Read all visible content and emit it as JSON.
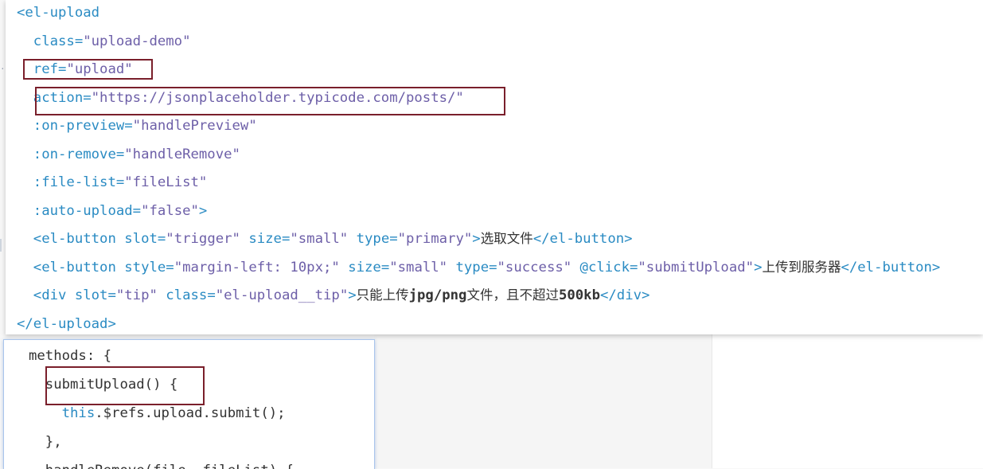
{
  "colors": {
    "tag": "#2a8bc3",
    "attr": "#2a8bc3",
    "value": "#6d5fa8",
    "text": "#333333",
    "keyword": "#2a8bc3",
    "highlight_box": "#7a1f2b"
  },
  "template_code": {
    "lines": [
      {
        "parts": [
          {
            "t": "tag",
            "v": "<el-upload"
          }
        ]
      },
      {
        "parts": [
          {
            "t": "attr",
            "v": "  class="
          },
          {
            "t": "value",
            "v": "\"upload-demo\""
          }
        ]
      },
      {
        "parts": [
          {
            "t": "attr",
            "v": "  ref="
          },
          {
            "t": "value",
            "v": "\"upload\""
          }
        ]
      },
      {
        "parts": [
          {
            "t": "attr",
            "v": "  action="
          },
          {
            "t": "value",
            "v": "\"https://jsonplaceholder.typicode.com/posts/\""
          }
        ]
      },
      {
        "parts": [
          {
            "t": "attr",
            "v": "  :on-preview="
          },
          {
            "t": "value",
            "v": "\"handlePreview\""
          }
        ]
      },
      {
        "parts": [
          {
            "t": "attr",
            "v": "  :on-remove="
          },
          {
            "t": "value",
            "v": "\"handleRemove\""
          }
        ]
      },
      {
        "parts": [
          {
            "t": "attr",
            "v": "  :file-list="
          },
          {
            "t": "value",
            "v": "\"fileList\""
          }
        ]
      },
      {
        "parts": [
          {
            "t": "attr",
            "v": "  :auto-upload="
          },
          {
            "t": "value",
            "v": "\"false\""
          },
          {
            "t": "tag",
            "v": ">"
          }
        ]
      },
      {
        "parts": [
          {
            "t": "tag",
            "v": "  <el-button "
          },
          {
            "t": "attr",
            "v": "slot="
          },
          {
            "t": "value",
            "v": "\"trigger\""
          },
          {
            "t": "attr",
            "v": " size="
          },
          {
            "t": "value",
            "v": "\"small\""
          },
          {
            "t": "attr",
            "v": " type="
          },
          {
            "t": "value",
            "v": "\"primary\""
          },
          {
            "t": "tag",
            "v": ">"
          },
          {
            "t": "cjk",
            "v": "选取文件"
          },
          {
            "t": "tag",
            "v": "</el-button>"
          }
        ]
      },
      {
        "parts": [
          {
            "t": "tag",
            "v": "  <el-button "
          },
          {
            "t": "attr",
            "v": "style="
          },
          {
            "t": "value",
            "v": "\"margin-left: 10px;\""
          },
          {
            "t": "attr",
            "v": " size="
          },
          {
            "t": "value",
            "v": "\"small\""
          },
          {
            "t": "attr",
            "v": " type="
          },
          {
            "t": "value",
            "v": "\"success\""
          },
          {
            "t": "attr",
            "v": " @click="
          },
          {
            "t": "value",
            "v": "\"submitUpload\""
          },
          {
            "t": "tag",
            "v": ">"
          },
          {
            "t": "cjk",
            "v": "上传到服务器"
          },
          {
            "t": "tag",
            "v": "</el-button>"
          }
        ]
      },
      {
        "parts": [
          {
            "t": "tag",
            "v": "  <div "
          },
          {
            "t": "attr",
            "v": "slot="
          },
          {
            "t": "value",
            "v": "\"tip\""
          },
          {
            "t": "attr",
            "v": " class="
          },
          {
            "t": "value",
            "v": "\"el-upload__tip\""
          },
          {
            "t": "tag",
            "v": ">"
          },
          {
            "t": "cjk",
            "v": "只能上传"
          },
          {
            "t": "text",
            "v": "jpg/png"
          },
          {
            "t": "cjk",
            "v": "文件，且不超过"
          },
          {
            "t": "text",
            "v": "500kb"
          },
          {
            "t": "tag",
            "v": "</div>"
          }
        ]
      },
      {
        "parts": [
          {
            "t": "tag",
            "v": "</el-upload>"
          }
        ]
      }
    ]
  },
  "methods_code": {
    "lines": [
      {
        "parts": [
          {
            "t": "text",
            "v": "methods: {"
          }
        ]
      },
      {
        "parts": [
          {
            "t": "text",
            "v": "  submitUpload() {"
          }
        ]
      },
      {
        "parts": [
          {
            "t": "keyword",
            "v": "    this"
          },
          {
            "t": "text",
            "v": ".$refs.upload.submit();"
          }
        ]
      },
      {
        "parts": [
          {
            "t": "text",
            "v": "  },"
          }
        ]
      },
      {
        "parts": [
          {
            "t": "text",
            "v": "  handleRemove(file, fileList) {"
          }
        ]
      }
    ]
  }
}
